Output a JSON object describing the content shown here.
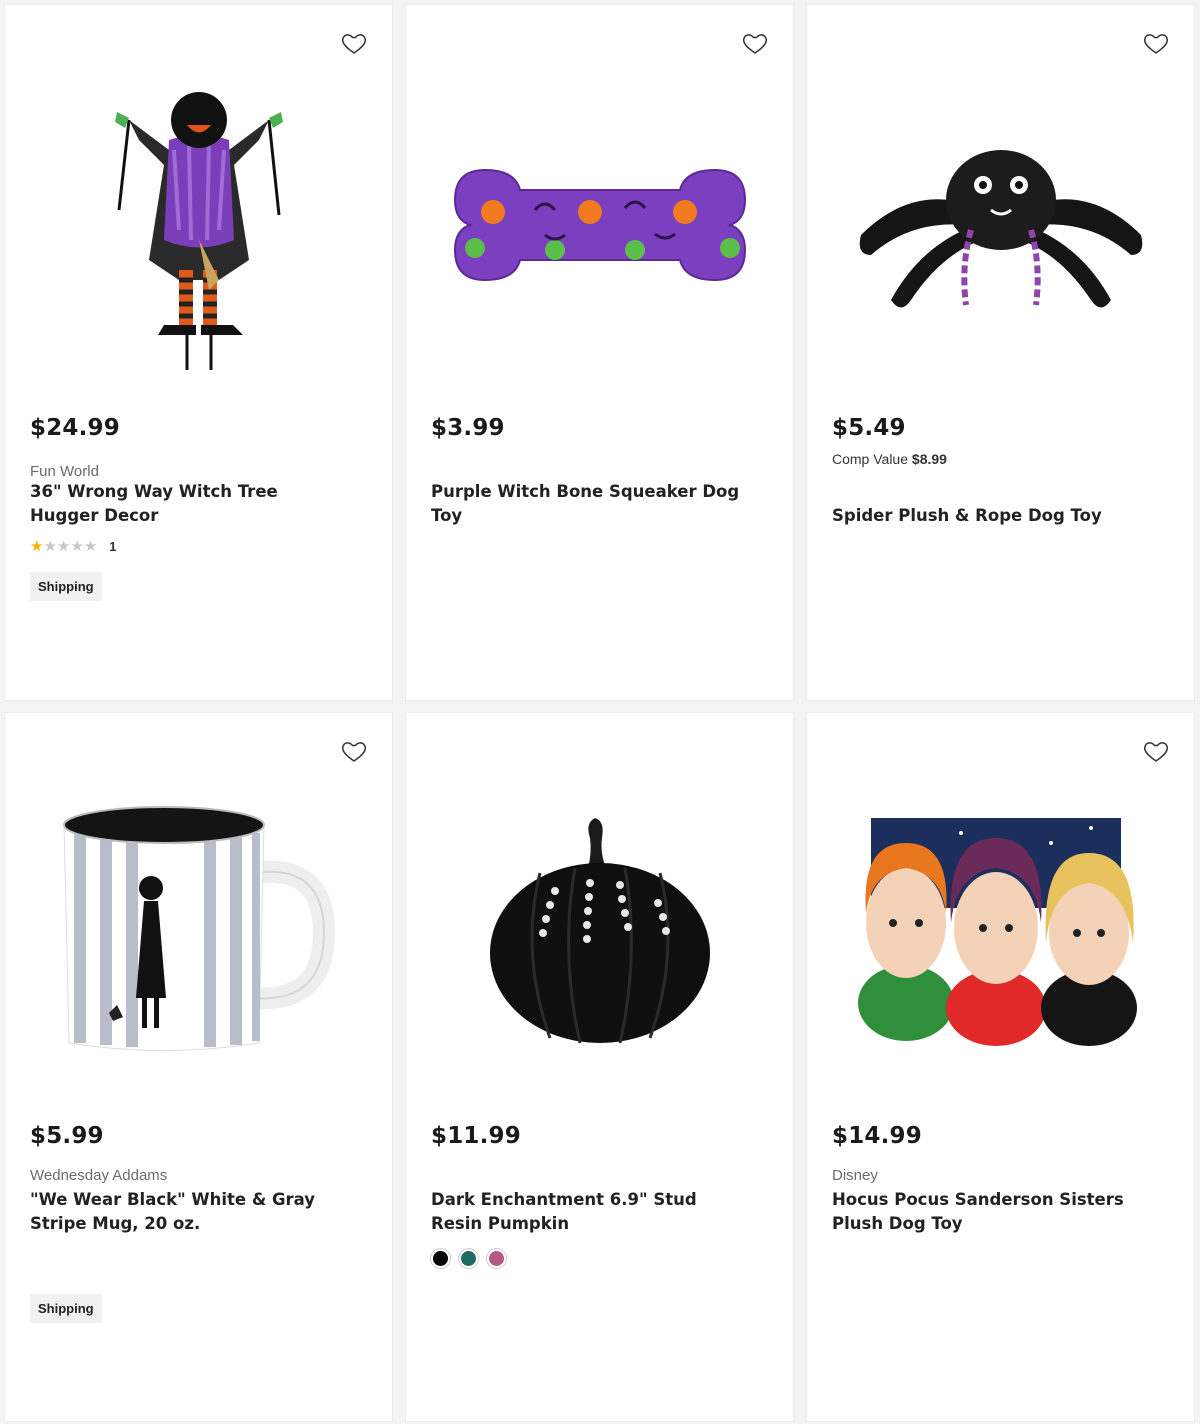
{
  "products": [
    {
      "price": "$24.99",
      "brand": "Fun World",
      "name": "36\" Wrong Way Witch Tree Hugger Decor",
      "rating": {
        "stars": 1,
        "max": 5,
        "count": "1"
      },
      "badge": "Shipping",
      "image": "witch-tree-hugger-image"
    },
    {
      "price": "$3.99",
      "name": "Purple Witch Bone Squeaker Dog Toy",
      "image": "purple-bone-toy-image"
    },
    {
      "price": "$5.49",
      "comp_label": "Comp Value",
      "comp_value": "$8.99",
      "name": "Spider Plush & Rope Dog Toy",
      "image": "spider-plush-image"
    },
    {
      "price": "$5.99",
      "brand": "Wednesday Addams",
      "name": "\"We Wear Black\" White & Gray Stripe Mug, 20 oz.",
      "badge": "Shipping",
      "image": "wednesday-mug-image"
    },
    {
      "price": "$11.99",
      "name": "Dark Enchantment 6.9\" Stud Resin Pumpkin",
      "swatches": [
        "#000000",
        "#1f6b62",
        "#b45a82"
      ],
      "image": "black-pumpkin-image"
    },
    {
      "price": "$14.99",
      "brand": "Disney",
      "name": "Hocus Pocus Sanderson Sisters Plush Dog Toy",
      "image": "sanderson-sisters-plush-image"
    }
  ],
  "colors": {
    "star_on": "#f0b400",
    "star_off": "#c8c8c8",
    "badge_bg": "#f1f1f1"
  }
}
